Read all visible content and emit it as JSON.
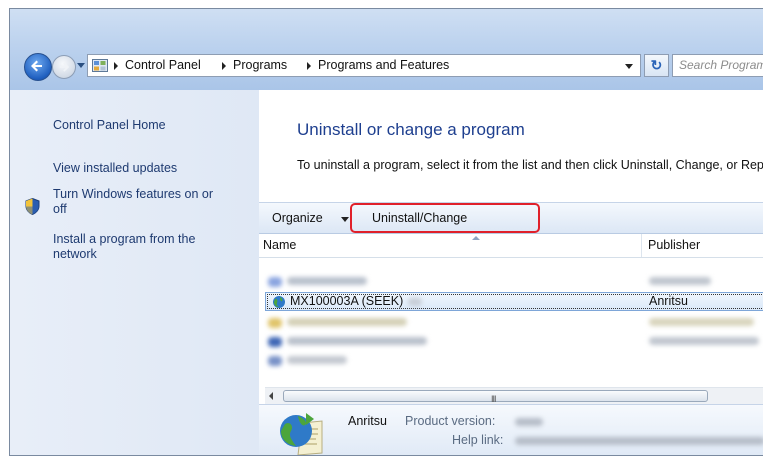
{
  "nav": {
    "breadcrumbs": [
      "Control Panel",
      "Programs",
      "Programs and Features"
    ],
    "search_placeholder": "Search Programs and Features"
  },
  "sidebar": {
    "home": "Control Panel Home",
    "items": [
      {
        "label": "View installed updates"
      },
      {
        "label_line1": "Turn Windows features on or",
        "label_line2": "off"
      },
      {
        "label_line1": "Install a program from the",
        "label_line2": "network"
      }
    ]
  },
  "main": {
    "title": "Uninstall or change a program",
    "description": "To uninstall a program, select it from the list and then click Uninstall, Change, or Repair."
  },
  "toolbar": {
    "organize_label": "Organize",
    "uninstall_label": "Uninstall/Change"
  },
  "columns": {
    "name": "Name",
    "publisher": "Publisher"
  },
  "selected_program": {
    "name": "MX100003A (SEEK)",
    "publisher": "Anritsu"
  },
  "scrollbar": {
    "grip": "III"
  },
  "details": {
    "publisher": "Anritsu",
    "version_label": "Product version:",
    "help_label": "Help link:"
  },
  "colors": {
    "highlight_box": "#e0202a",
    "title": "#1e3f8f",
    "link": "#1e3a70"
  }
}
